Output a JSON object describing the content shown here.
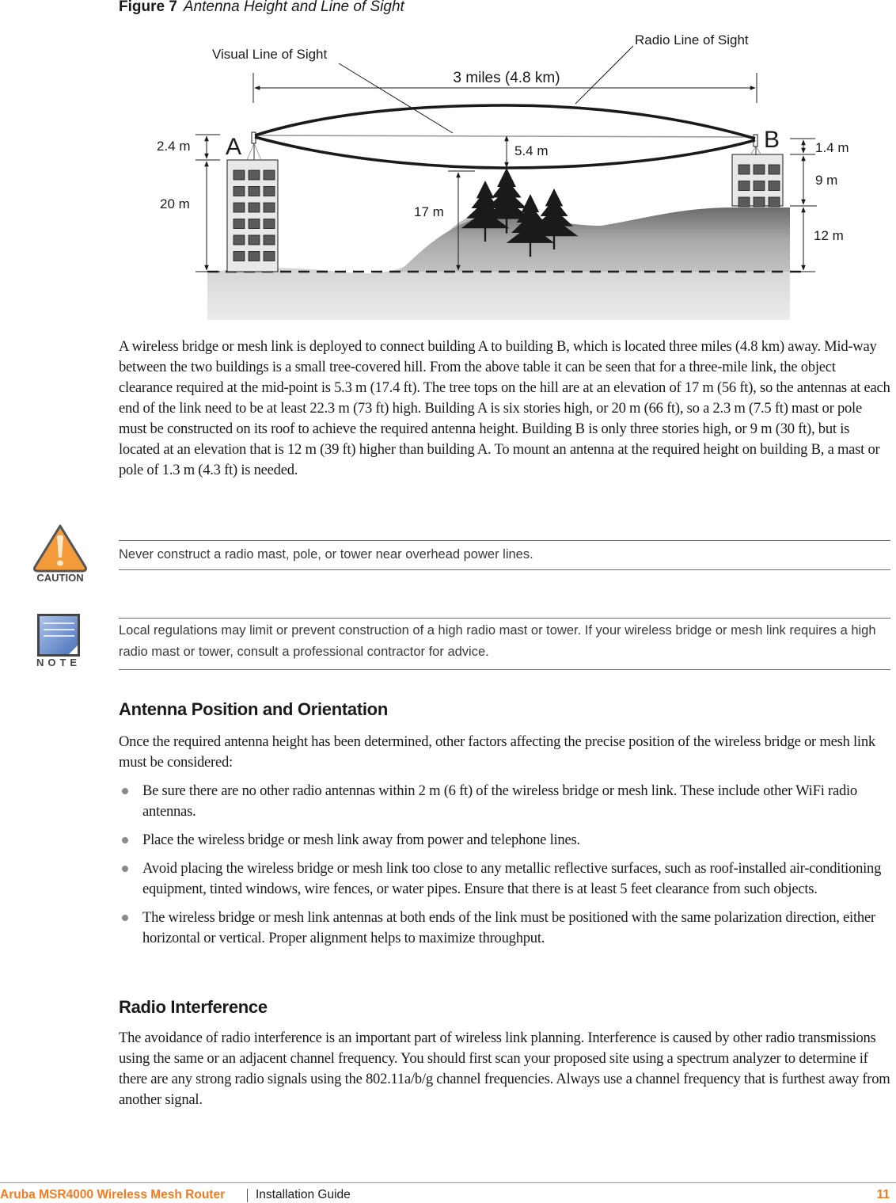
{
  "figure": {
    "label": "Figure 7",
    "title": "Antenna Height and Line of Sight",
    "labels": {
      "visual_los": "Visual Line of Sight",
      "radio_los": "Radio Line of Sight",
      "distance": "3 miles (4.8 km)",
      "building_a": "A",
      "building_b": "B",
      "mast_a": "2.4 m",
      "height_a": "20 m",
      "clearance": "5.4 m",
      "trees": "17 m",
      "mast_b": "1.4 m",
      "height_b": "9 m",
      "elevation_b": "12 m"
    }
  },
  "paragraphs": {
    "intro": "A wireless bridge or mesh link is deployed to connect building A to building B, which is located three miles (4.8 km) away. Mid-way between the two buildings is a small tree-covered hill. From the above table it can be seen that for a three-mile link, the object clearance required at the mid-point is 5.3 m (17.4 ft). The tree tops on the hill are at an elevation of 17 m (56 ft), so the antennas at each end of the link need to be at least 22.3 m (73 ft) high. Building A is six stories high, or 20 m (66 ft), so a 2.3 m (7.5 ft) mast or pole must be constructed on its roof to achieve the required antenna height. Building B is only three stories high, or 9 m (30 ft), but is located at an elevation that is 12 m (39 ft) higher than building A. To mount an antenna at the required height on building B, a mast or pole of 1.3 m (4.3 ft) is needed."
  },
  "caution": {
    "icon_label": "CAUTION",
    "text": "Never construct a radio mast, pole, or tower near overhead power lines."
  },
  "note": {
    "icon_label": "NOTE",
    "text": "Local regulations may limit or prevent construction of a high radio mast or tower. If your wireless bridge or mesh link requires a high radio mast or tower, consult a professional contractor for advice."
  },
  "section_antenna": {
    "heading": "Antenna Position and Orientation",
    "intro": "Once the required antenna height has been determined, other factors affecting the precise position of the wireless bridge or mesh link must be considered:",
    "bullets": [
      "Be sure there are no other radio antennas within 2 m (6 ft) of the wireless bridge or mesh link. These include other WiFi radio antennas.",
      "Place the wireless bridge or mesh link away from power and telephone lines.",
      "Avoid placing the wireless bridge or mesh link too close to any metallic reflective surfaces, such as roof-installed air-conditioning equipment, tinted windows, wire fences, or water pipes. Ensure that there is at least 5 feet clearance from such objects.",
      "The wireless bridge or mesh link antennas at both ends of the link must be positioned with the same polarization direction, either horizontal or vertical. Proper alignment helps to maximize throughput."
    ]
  },
  "section_radio": {
    "heading": "Radio Interference",
    "text": "The avoidance of radio interference is an important part of wireless link planning. Interference is caused by other radio transmissions using the same or an adjacent channel frequency. You should first scan your proposed site using a spectrum analyzer to determine if there are any strong radio signals using the 802.11a/b/g channel frequencies. Always use a channel frequency that is furthest away from another signal."
  },
  "footer": {
    "product": "Aruba MSR4000 Wireless Mesh Router",
    "doc_type": "Installation Guide",
    "page_number": "11"
  },
  "colors": {
    "brand_orange": "#f47a20",
    "caution_orange": "#f39a3a",
    "note_blue": "#5b82c4"
  }
}
